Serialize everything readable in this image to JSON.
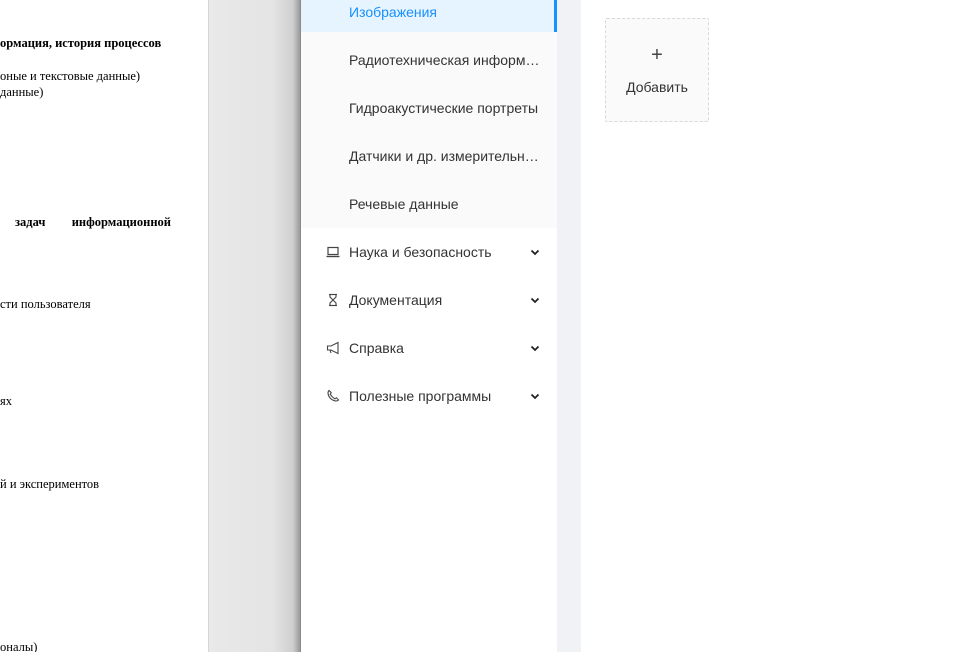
{
  "document": {
    "lines": [
      "ормация,  история  процессов",
      "оные и текстовые данные)",
      "данные)",
      [
        "задач",
        "информационной"
      ],
      "сти пользователя",
      "ях",
      "й и экспериментов",
      "оналы)"
    ]
  },
  "sidebar": {
    "submenu": [
      {
        "label": "Изображения",
        "active": true
      },
      {
        "label": "Радиотехническая информация"
      },
      {
        "label": "Гидроакустические портреты"
      },
      {
        "label": "Датчики и др. измерительные приборы"
      },
      {
        "label": "Речевые данные"
      }
    ],
    "items": [
      {
        "label": "Наука и безопасность",
        "icon": "laptop-icon"
      },
      {
        "label": "Документация",
        "icon": "hourglass-icon"
      },
      {
        "label": "Справка",
        "icon": "megaphone-icon"
      },
      {
        "label": "Полезные программы",
        "icon": "phone-icon"
      }
    ]
  },
  "main": {
    "add_card": {
      "plus": "+",
      "label": "Добавить"
    }
  },
  "colors": {
    "accent": "#1890ff",
    "active_bg": "#e6f4ff",
    "strip": "#f0f2f5",
    "text": "#333333"
  }
}
